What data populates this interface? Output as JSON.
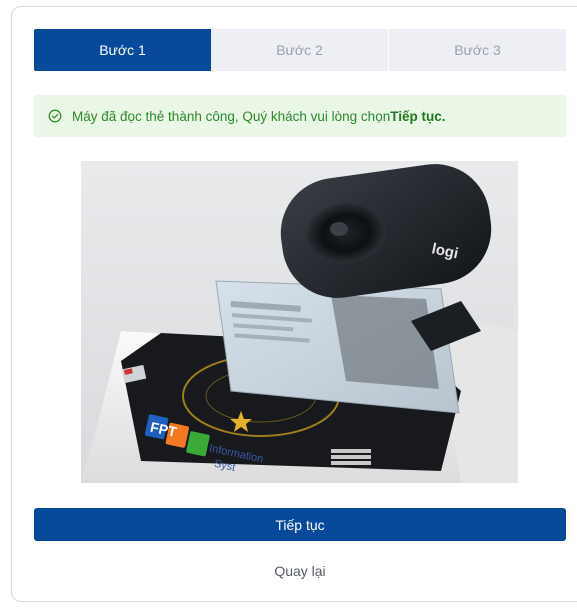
{
  "steps": [
    {
      "label": "Bước 1",
      "state": "active"
    },
    {
      "label": "Bước 2",
      "state": "inactive"
    },
    {
      "label": "Bước 3",
      "state": "inactive"
    }
  ],
  "alert": {
    "icon": "check-circle-icon",
    "message": "Máy đã đọc thẻ thành công, Quý khách vui lòng chọn ",
    "emphasis": "Tiếp tục."
  },
  "photo": {
    "webcam_brand": "logi",
    "device_brand": "FPT",
    "device_text_line1": "Information",
    "device_text_line2": "Syst"
  },
  "actions": {
    "continue_label": "Tiếp tục",
    "back_label": "Quay lại"
  },
  "colors": {
    "primary": "#074a9c",
    "success_text": "#2b8a2b",
    "success_bg": "#eaf7e6",
    "inactive_step_bg": "#eeeff4"
  }
}
